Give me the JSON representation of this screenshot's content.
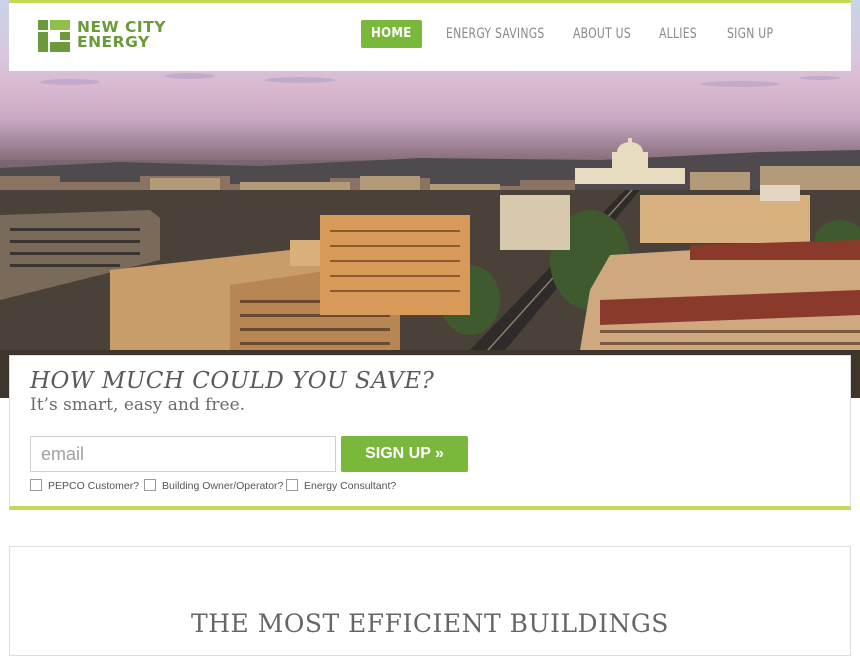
{
  "brand": {
    "name_line1": "NEW CITY",
    "name_line2": "ENERGY",
    "logo_icon": "nce-logo-icon",
    "accent_color": "#79b83a",
    "header_rule_color": "#c3d957"
  },
  "nav": {
    "items": [
      {
        "label": "HOME",
        "active": true
      },
      {
        "label": "ENERGY SAVINGS",
        "active": false
      },
      {
        "label": "ABOUT US",
        "active": false
      },
      {
        "label": "ALLIES",
        "active": false
      },
      {
        "label": "SIGN UP",
        "active": false
      }
    ]
  },
  "hero": {
    "image": "washington-dc-skyline-photo"
  },
  "save": {
    "title": "HOW MUCH COULD YOU SAVE?",
    "subtitle": "It’s smart, easy and free.",
    "email_placeholder": "email",
    "email_value": "",
    "signup_label": "SIGN UP »",
    "checkboxes": [
      {
        "label": "PEPCO Customer?",
        "checked": false
      },
      {
        "label": "Building Owner/Operator?",
        "checked": false
      },
      {
        "label": "Energy Consultant?",
        "checked": false
      }
    ]
  },
  "section": {
    "title": "THE MOST EFFICIENT BUILDINGS"
  }
}
